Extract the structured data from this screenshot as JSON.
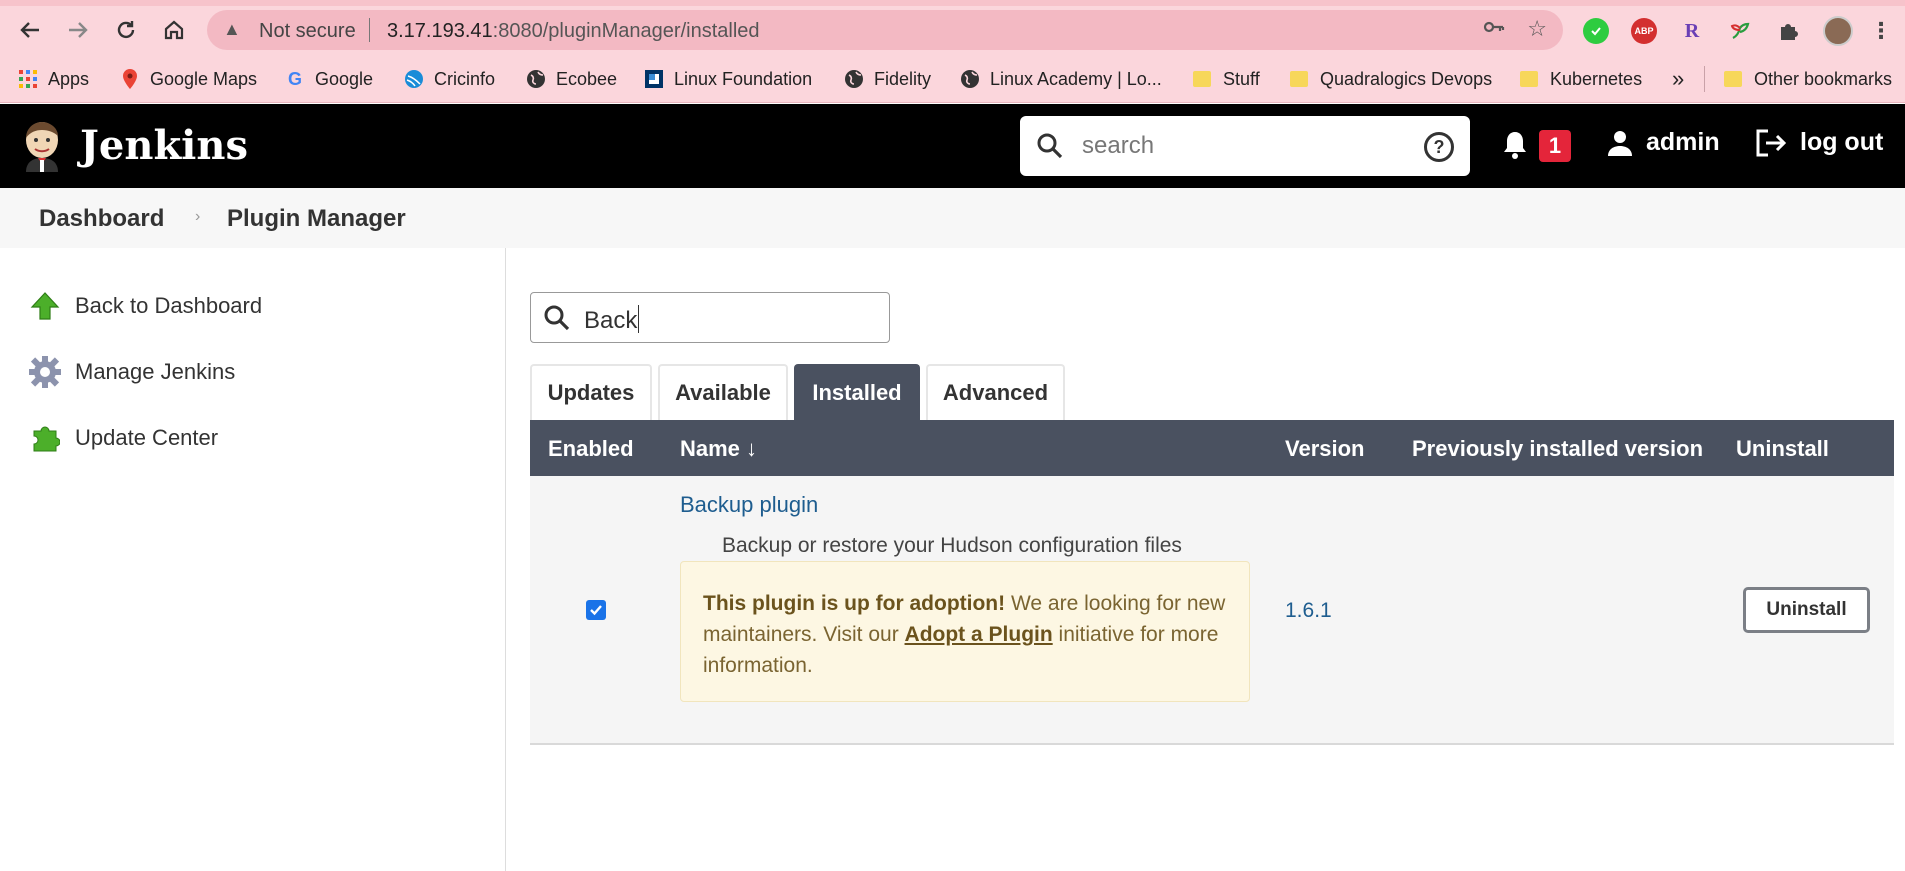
{
  "browser": {
    "omnibox": {
      "security": "Not secure",
      "url_host": "3.17.193.41",
      "url_rest": ":8080/pluginManager/installed"
    },
    "extensions": [
      "ABP",
      "R"
    ],
    "bookmarks": [
      {
        "label": "Apps",
        "icon": "apps-grid-icon"
      },
      {
        "label": "Google Maps",
        "icon": "google-maps-icon"
      },
      {
        "label": "Google",
        "icon": "google-icon"
      },
      {
        "label": "Cricinfo",
        "icon": "cricinfo-icon"
      },
      {
        "label": "Ecobee",
        "icon": "globe-icon"
      },
      {
        "label": "Linux Foundation",
        "icon": "linux-foundation-icon"
      },
      {
        "label": "Fidelity",
        "icon": "globe-icon"
      },
      {
        "label": "Linux Academy | Lo...",
        "icon": "globe-icon"
      },
      {
        "label": "Stuff",
        "icon": "folder-icon"
      },
      {
        "label": "Quadralogics Devops",
        "icon": "folder-icon"
      },
      {
        "label": "Kubernetes",
        "icon": "folder-icon"
      }
    ],
    "overflow": "»",
    "other_bookmarks": "Other bookmarks"
  },
  "header": {
    "title": "Jenkins",
    "search_placeholder": "search",
    "help": "?",
    "notification_count": "1",
    "user": "admin",
    "logout": "log out"
  },
  "breadcrumb": {
    "items": [
      "Dashboard",
      "Plugin Manager"
    ]
  },
  "sidebar": {
    "items": [
      {
        "label": "Back to Dashboard",
        "icon": "up-arrow-icon"
      },
      {
        "label": "Manage Jenkins",
        "icon": "gear-icon"
      },
      {
        "label": "Update Center",
        "icon": "puzzle-icon"
      }
    ]
  },
  "filter": {
    "value": "Back"
  },
  "tabs": [
    {
      "label": "Updates",
      "active": false
    },
    {
      "label": "Available",
      "active": false
    },
    {
      "label": "Installed",
      "active": true
    },
    {
      "label": "Advanced",
      "active": false
    }
  ],
  "table": {
    "headers": {
      "enabled": "Enabled",
      "name": "Name",
      "name_sort": "↓",
      "version": "Version",
      "previous": "Previously installed version",
      "uninstall": "Uninstall"
    },
    "rows": [
      {
        "enabled": true,
        "name": "Backup plugin",
        "description": "Backup or restore your Hudson configuration files",
        "adoption": {
          "bold": "This plugin is up for adoption!",
          "text1": " We are looking for new maintainers. Visit our ",
          "link": "Adopt a Plugin",
          "text2": " initiative for more information."
        },
        "version": "1.6.1",
        "previous_version": "",
        "uninstall_label": "Uninstall"
      }
    ]
  },
  "colors": {
    "chrome_bg": "#fbd6dc",
    "header_bg": "#000000",
    "table_head_bg": "#4a5160",
    "link": "#1e5d8f",
    "badge": "#e4253a"
  }
}
